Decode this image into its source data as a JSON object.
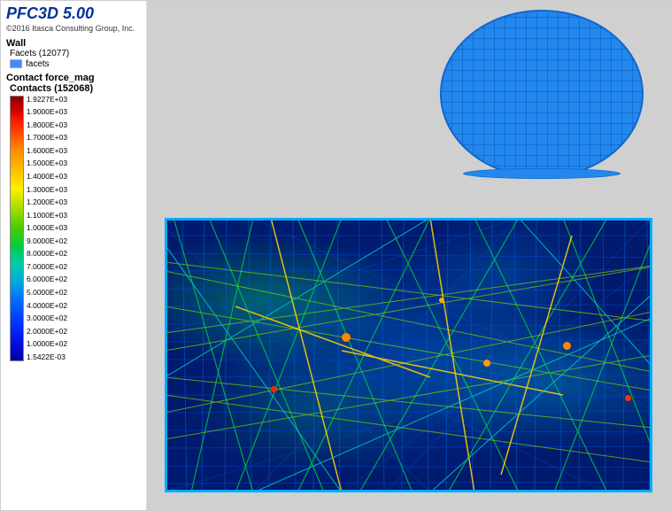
{
  "app": {
    "title": "PFC3D 5.00",
    "copyright": "©2016 Itasca Consulting Group, Inc."
  },
  "sidebar": {
    "wall_label": "Wall",
    "facets_label": "Facets (12077)",
    "facet_item": "facets",
    "contact_force_label": "Contact force_mag",
    "contacts_label": "Contacts (152068)",
    "legend": {
      "values": [
        "1.9227E+03",
        "1.9000E+03",
        "1.8000E+03",
        "1.7000E+03",
        "1.6000E+03",
        "1.5000E+03",
        "1.4000E+03",
        "1.3000E+03",
        "1.2000E+03",
        "1.1000E+03",
        "1.0000E+03",
        "9.0000E+02",
        "8.0000E+02",
        "7.0000E+02",
        "6.0000E+02",
        "5.0000E+02",
        "4.0000E+02",
        "3.0000E+02",
        "2.0000E+02",
        "1.0000E+02",
        "1.5422E-03"
      ]
    }
  }
}
